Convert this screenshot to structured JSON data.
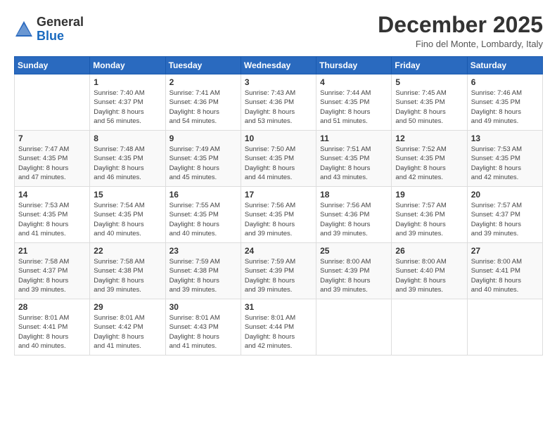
{
  "logo": {
    "general": "General",
    "blue": "Blue"
  },
  "header": {
    "month": "December 2025",
    "location": "Fino del Monte, Lombardy, Italy"
  },
  "weekdays": [
    "Sunday",
    "Monday",
    "Tuesday",
    "Wednesday",
    "Thursday",
    "Friday",
    "Saturday"
  ],
  "weeks": [
    [
      {
        "day": "",
        "info": ""
      },
      {
        "day": "1",
        "info": "Sunrise: 7:40 AM\nSunset: 4:37 PM\nDaylight: 8 hours\nand 56 minutes."
      },
      {
        "day": "2",
        "info": "Sunrise: 7:41 AM\nSunset: 4:36 PM\nDaylight: 8 hours\nand 54 minutes."
      },
      {
        "day": "3",
        "info": "Sunrise: 7:43 AM\nSunset: 4:36 PM\nDaylight: 8 hours\nand 53 minutes."
      },
      {
        "day": "4",
        "info": "Sunrise: 7:44 AM\nSunset: 4:35 PM\nDaylight: 8 hours\nand 51 minutes."
      },
      {
        "day": "5",
        "info": "Sunrise: 7:45 AM\nSunset: 4:35 PM\nDaylight: 8 hours\nand 50 minutes."
      },
      {
        "day": "6",
        "info": "Sunrise: 7:46 AM\nSunset: 4:35 PM\nDaylight: 8 hours\nand 49 minutes."
      }
    ],
    [
      {
        "day": "7",
        "info": "Sunrise: 7:47 AM\nSunset: 4:35 PM\nDaylight: 8 hours\nand 47 minutes."
      },
      {
        "day": "8",
        "info": "Sunrise: 7:48 AM\nSunset: 4:35 PM\nDaylight: 8 hours\nand 46 minutes."
      },
      {
        "day": "9",
        "info": "Sunrise: 7:49 AM\nSunset: 4:35 PM\nDaylight: 8 hours\nand 45 minutes."
      },
      {
        "day": "10",
        "info": "Sunrise: 7:50 AM\nSunset: 4:35 PM\nDaylight: 8 hours\nand 44 minutes."
      },
      {
        "day": "11",
        "info": "Sunrise: 7:51 AM\nSunset: 4:35 PM\nDaylight: 8 hours\nand 43 minutes."
      },
      {
        "day": "12",
        "info": "Sunrise: 7:52 AM\nSunset: 4:35 PM\nDaylight: 8 hours\nand 42 minutes."
      },
      {
        "day": "13",
        "info": "Sunrise: 7:53 AM\nSunset: 4:35 PM\nDaylight: 8 hours\nand 42 minutes."
      }
    ],
    [
      {
        "day": "14",
        "info": "Sunrise: 7:53 AM\nSunset: 4:35 PM\nDaylight: 8 hours\nand 41 minutes."
      },
      {
        "day": "15",
        "info": "Sunrise: 7:54 AM\nSunset: 4:35 PM\nDaylight: 8 hours\nand 40 minutes."
      },
      {
        "day": "16",
        "info": "Sunrise: 7:55 AM\nSunset: 4:35 PM\nDaylight: 8 hours\nand 40 minutes."
      },
      {
        "day": "17",
        "info": "Sunrise: 7:56 AM\nSunset: 4:35 PM\nDaylight: 8 hours\nand 39 minutes."
      },
      {
        "day": "18",
        "info": "Sunrise: 7:56 AM\nSunset: 4:36 PM\nDaylight: 8 hours\nand 39 minutes."
      },
      {
        "day": "19",
        "info": "Sunrise: 7:57 AM\nSunset: 4:36 PM\nDaylight: 8 hours\nand 39 minutes."
      },
      {
        "day": "20",
        "info": "Sunrise: 7:57 AM\nSunset: 4:37 PM\nDaylight: 8 hours\nand 39 minutes."
      }
    ],
    [
      {
        "day": "21",
        "info": "Sunrise: 7:58 AM\nSunset: 4:37 PM\nDaylight: 8 hours\nand 39 minutes."
      },
      {
        "day": "22",
        "info": "Sunrise: 7:58 AM\nSunset: 4:38 PM\nDaylight: 8 hours\nand 39 minutes."
      },
      {
        "day": "23",
        "info": "Sunrise: 7:59 AM\nSunset: 4:38 PM\nDaylight: 8 hours\nand 39 minutes."
      },
      {
        "day": "24",
        "info": "Sunrise: 7:59 AM\nSunset: 4:39 PM\nDaylight: 8 hours\nand 39 minutes."
      },
      {
        "day": "25",
        "info": "Sunrise: 8:00 AM\nSunset: 4:39 PM\nDaylight: 8 hours\nand 39 minutes."
      },
      {
        "day": "26",
        "info": "Sunrise: 8:00 AM\nSunset: 4:40 PM\nDaylight: 8 hours\nand 39 minutes."
      },
      {
        "day": "27",
        "info": "Sunrise: 8:00 AM\nSunset: 4:41 PM\nDaylight: 8 hours\nand 40 minutes."
      }
    ],
    [
      {
        "day": "28",
        "info": "Sunrise: 8:01 AM\nSunset: 4:41 PM\nDaylight: 8 hours\nand 40 minutes."
      },
      {
        "day": "29",
        "info": "Sunrise: 8:01 AM\nSunset: 4:42 PM\nDaylight: 8 hours\nand 41 minutes."
      },
      {
        "day": "30",
        "info": "Sunrise: 8:01 AM\nSunset: 4:43 PM\nDaylight: 8 hours\nand 41 minutes."
      },
      {
        "day": "31",
        "info": "Sunrise: 8:01 AM\nSunset: 4:44 PM\nDaylight: 8 hours\nand 42 minutes."
      },
      {
        "day": "",
        "info": ""
      },
      {
        "day": "",
        "info": ""
      },
      {
        "day": "",
        "info": ""
      }
    ]
  ]
}
